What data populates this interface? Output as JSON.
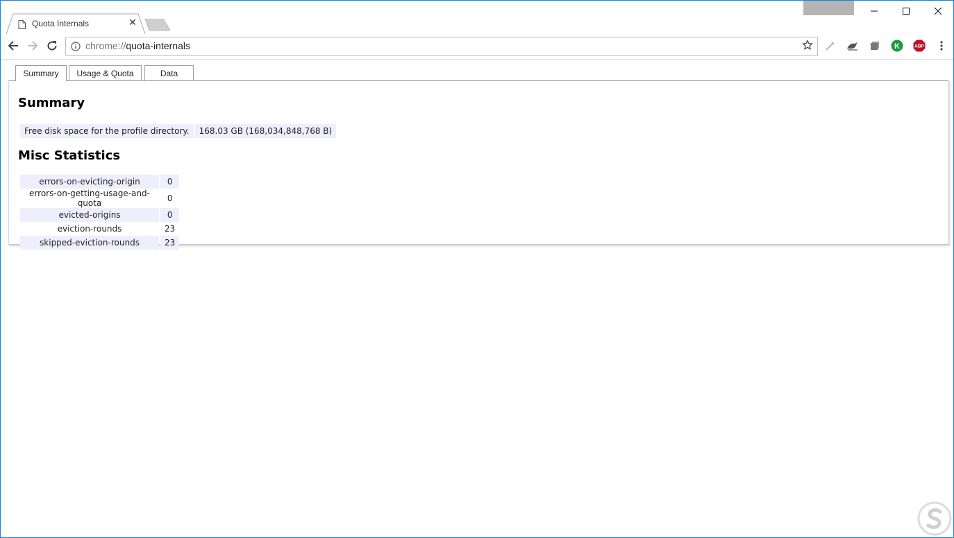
{
  "browser": {
    "tab": {
      "title": "Quota Internals",
      "icon": "page-icon"
    },
    "address": {
      "scheme": "chrome://",
      "path": "quota-internals"
    },
    "extensions": [
      "eyedropper-icon",
      "bird-icon",
      "stack-icon",
      "k-extension-icon",
      "abp-icon"
    ],
    "ext_labels": {
      "k": "K",
      "abp": "ABP"
    },
    "colors": {
      "k": "#1c9a3b",
      "abp": "#c0112a",
      "window_border": "#1883d7"
    }
  },
  "page_tabs": [
    "Summary",
    "Usage & Quota",
    "Data"
  ],
  "summary": {
    "heading": "Summary",
    "rows": [
      {
        "label": "Free disk space for the profile directory.",
        "value": "168.03 GB (168,034,848,768 B)"
      }
    ]
  },
  "misc": {
    "heading": "Misc Statistics",
    "rows": [
      {
        "key": "errors-on-evicting-origin",
        "value": "0"
      },
      {
        "key": "errors-on-getting-usage-and-quota",
        "value": "0"
      },
      {
        "key": "evicted-origins",
        "value": "0"
      },
      {
        "key": "eviction-rounds",
        "value": "23"
      },
      {
        "key": "skipped-eviction-rounds",
        "value": "23"
      }
    ]
  }
}
